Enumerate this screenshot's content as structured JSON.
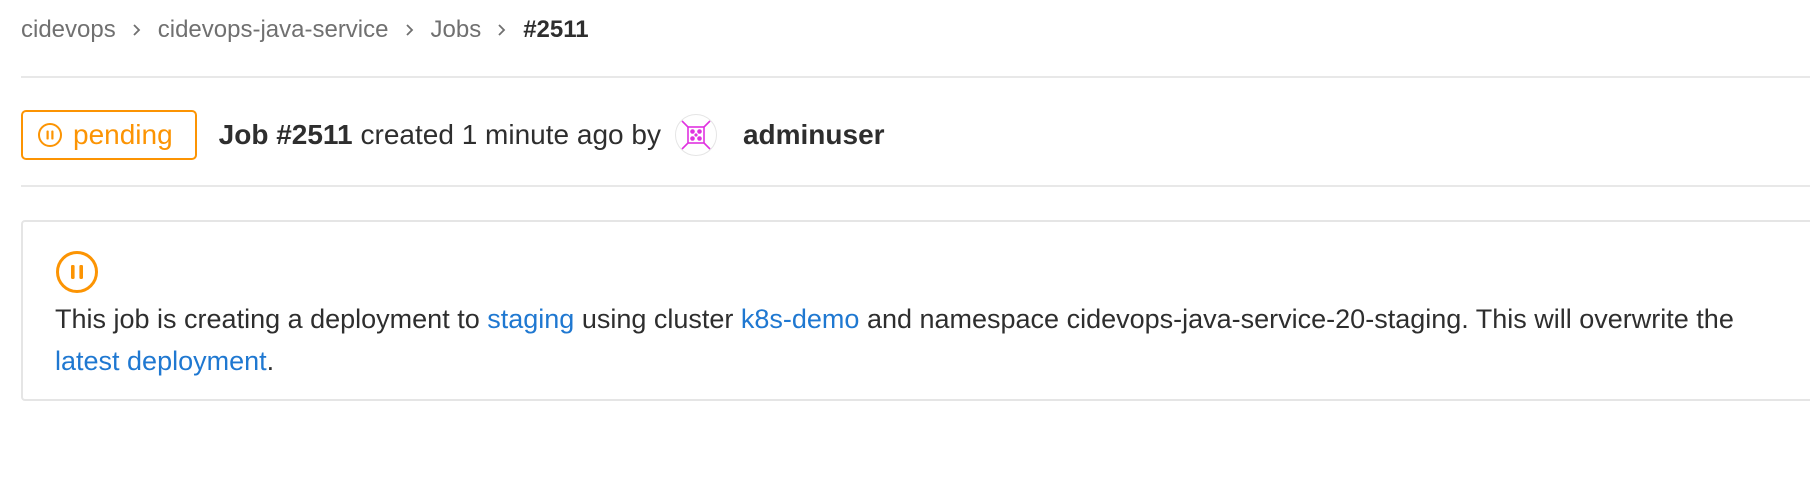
{
  "breadcrumb": {
    "items": [
      {
        "label": "cidevops"
      },
      {
        "label": "cidevops-java-service"
      },
      {
        "label": "Jobs"
      },
      {
        "label": "#2511"
      }
    ],
    "separator_icon": "chevron-right-icon"
  },
  "header": {
    "status": {
      "label": "pending",
      "icon": "status-pending-icon",
      "color": "#fc9403"
    },
    "job_title": "Job #2511",
    "meta": "created 1 minute ago by",
    "avatar_icon": "identicon-avatar",
    "username": "adminuser"
  },
  "environment": {
    "icon": "status-pending-icon",
    "text_1": "This job is creating a deployment to ",
    "environment_link": "staging",
    "text_2": " using cluster ",
    "cluster_link": "k8s-demo",
    "text_3": " and namespace cidevops-java-service-20-staging. This will overwrite the ",
    "deployment_link": "latest deployment",
    "text_4": "."
  },
  "colors": {
    "pending": "#fc9403",
    "link": "#1f78d1",
    "text": "#2e2e2e",
    "muted": "#707070",
    "avatar": "#e032e0"
  }
}
